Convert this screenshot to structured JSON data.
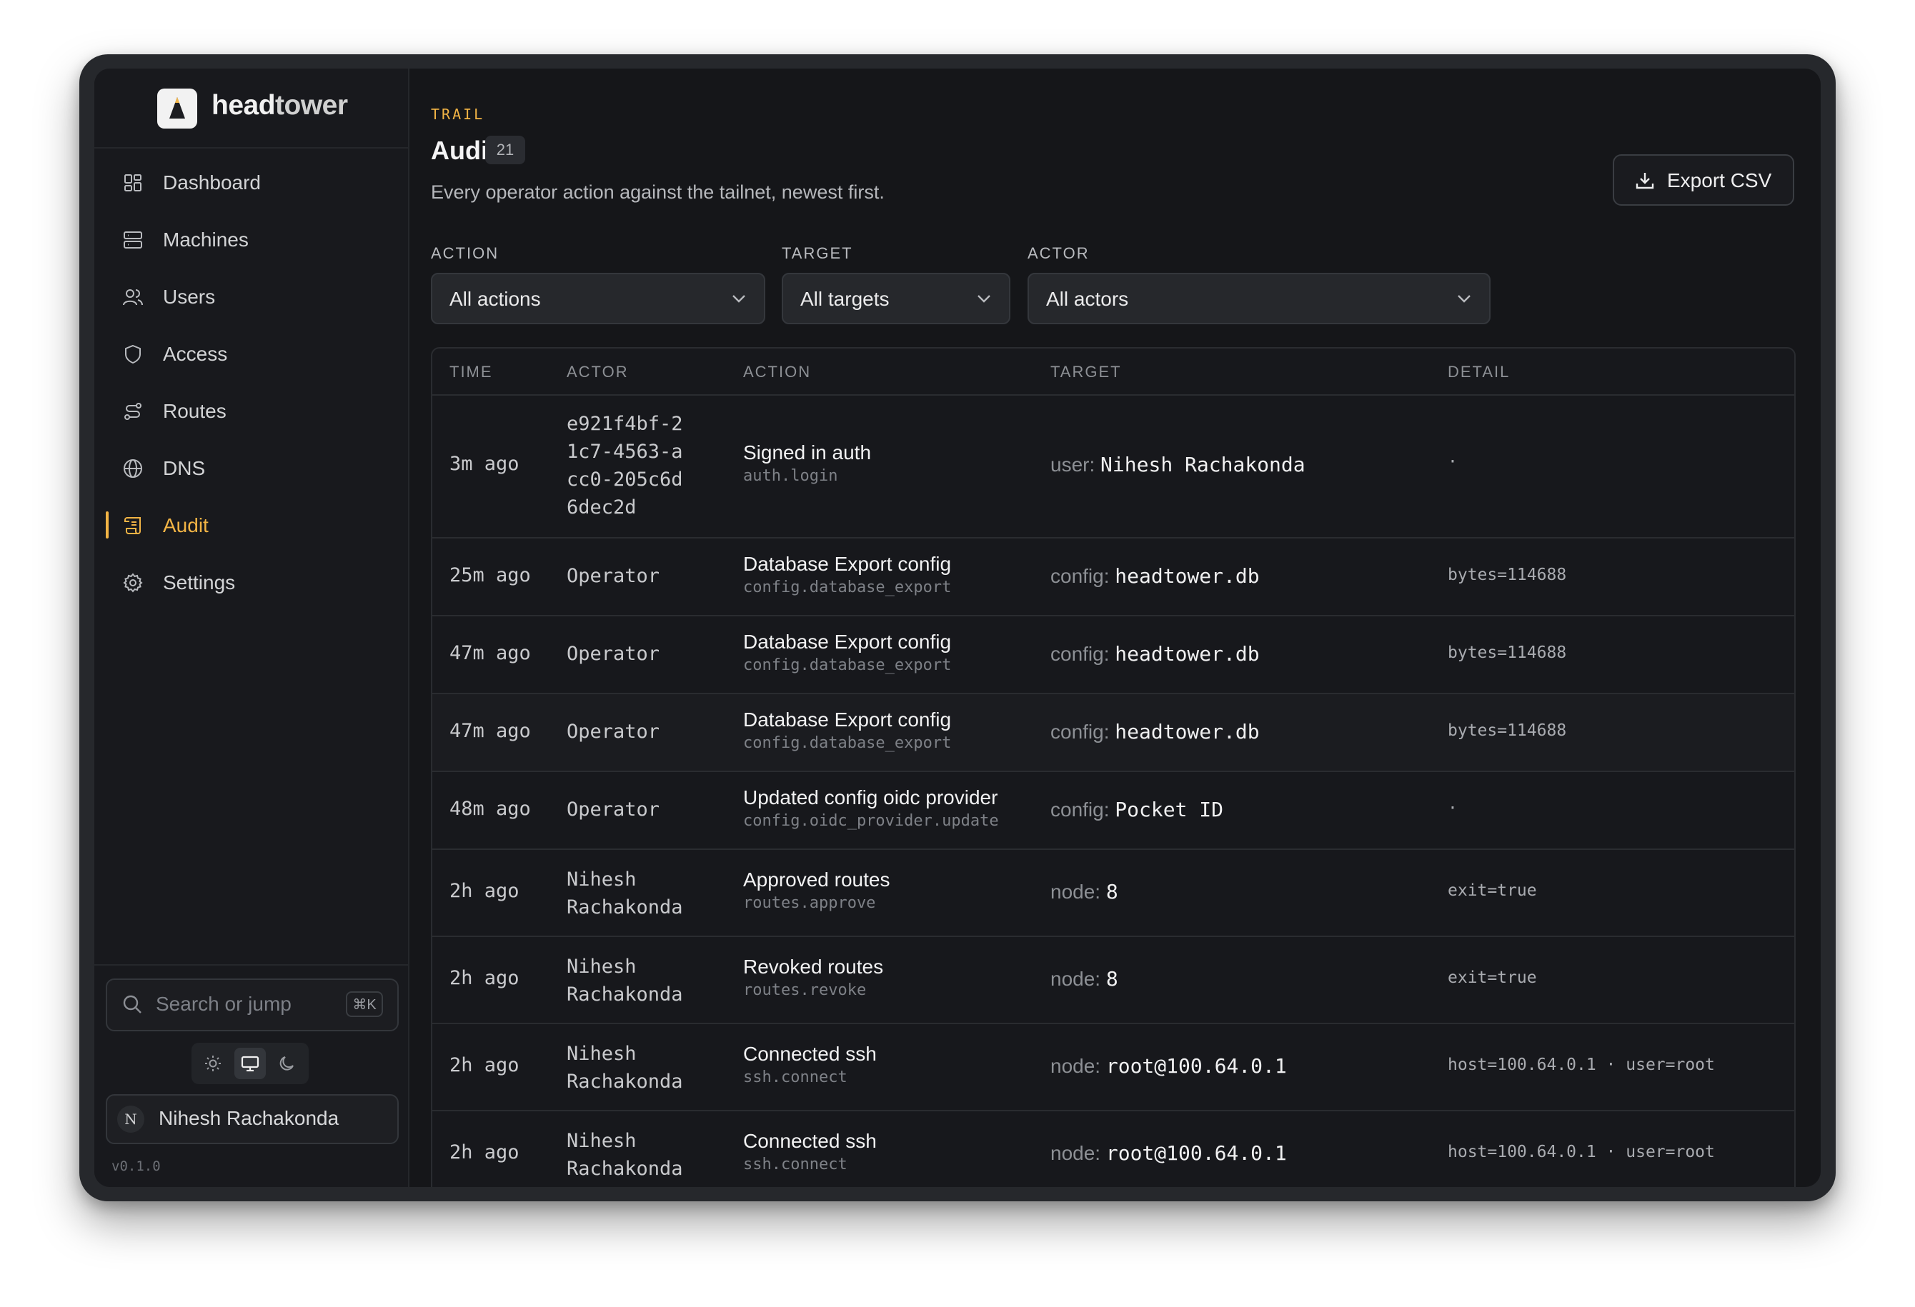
{
  "brand": {
    "name_bold": "head",
    "name_rest": "tower"
  },
  "nav": [
    {
      "label": "Dashboard",
      "icon": "dashboard-icon",
      "active": false
    },
    {
      "label": "Machines",
      "icon": "server-icon",
      "active": false
    },
    {
      "label": "Users",
      "icon": "users-icon",
      "active": false
    },
    {
      "label": "Access",
      "icon": "shield-icon",
      "active": false
    },
    {
      "label": "Routes",
      "icon": "routes-icon",
      "active": false
    },
    {
      "label": "DNS",
      "icon": "globe-icon",
      "active": false
    },
    {
      "label": "Audit",
      "icon": "scroll-icon",
      "active": true
    },
    {
      "label": "Settings",
      "icon": "gear-icon",
      "active": false
    }
  ],
  "search": {
    "placeholder": "Search or jump",
    "shortcut": "⌘K"
  },
  "user": {
    "name": "Nihesh Rachakonda",
    "avatar": "N"
  },
  "version": "v0.1.0",
  "header": {
    "eyebrow": "TRAIL",
    "title": "Audit",
    "count": "21",
    "subtitle": "Every operator action against the tailnet, newest first.",
    "export_label": "Export CSV"
  },
  "filters": {
    "action": {
      "label": "ACTION",
      "value": "All actions"
    },
    "target": {
      "label": "TARGET",
      "value": "All targets"
    },
    "actor": {
      "label": "ACTOR",
      "value": "All actors"
    }
  },
  "columns": [
    "TIME",
    "ACTOR",
    "ACTION",
    "TARGET",
    "DETAIL"
  ],
  "rows": [
    {
      "time": "3m ago",
      "actor": "e921f4bf-21c7-4563-acc0-205c6d6dec2d",
      "action": "Signed in auth",
      "code": "auth.login",
      "target_key": "user:",
      "target_val": "Nihesh Rachakonda",
      "detail": "·"
    },
    {
      "time": "25m ago",
      "actor": "Operator",
      "action": "Database Export config",
      "code": "config.database_export",
      "target_key": "config:",
      "target_val": "headtower.db",
      "detail": "bytes=114688"
    },
    {
      "time": "47m ago",
      "actor": "Operator",
      "action": "Database Export config",
      "code": "config.database_export",
      "target_key": "config:",
      "target_val": "headtower.db",
      "detail": "bytes=114688"
    },
    {
      "time": "47m ago",
      "actor": "Operator",
      "action": "Database Export config",
      "code": "config.database_export",
      "target_key": "config:",
      "target_val": "headtower.db",
      "detail": "bytes=114688"
    },
    {
      "time": "48m ago",
      "actor": "Operator",
      "action": "Updated config oidc provider",
      "code": "config.oidc_provider.update",
      "target_key": "config:",
      "target_val": "Pocket ID",
      "detail": "·"
    },
    {
      "time": "2h ago",
      "actor": "Nihesh Rachakonda",
      "action": "Approved routes",
      "code": "routes.approve",
      "target_key": "node:",
      "target_val": "8",
      "detail": "exit=true"
    },
    {
      "time": "2h ago",
      "actor": "Nihesh Rachakonda",
      "action": "Revoked routes",
      "code": "routes.revoke",
      "target_key": "node:",
      "target_val": "8",
      "detail": "exit=true"
    },
    {
      "time": "2h ago",
      "actor": "Nihesh Rachakonda",
      "action": "Connected ssh",
      "code": "ssh.connect",
      "target_key": "node:",
      "target_val": "root@100.64.0.1",
      "detail": "host=100.64.0.1 · user=root"
    },
    {
      "time": "2h ago",
      "actor": "Nihesh Rachakonda",
      "action": "Connected ssh",
      "code": "ssh.connect",
      "target_key": "node:",
      "target_val": "root@100.64.0.1",
      "detail": "host=100.64.0.1 · user=root"
    }
  ]
}
